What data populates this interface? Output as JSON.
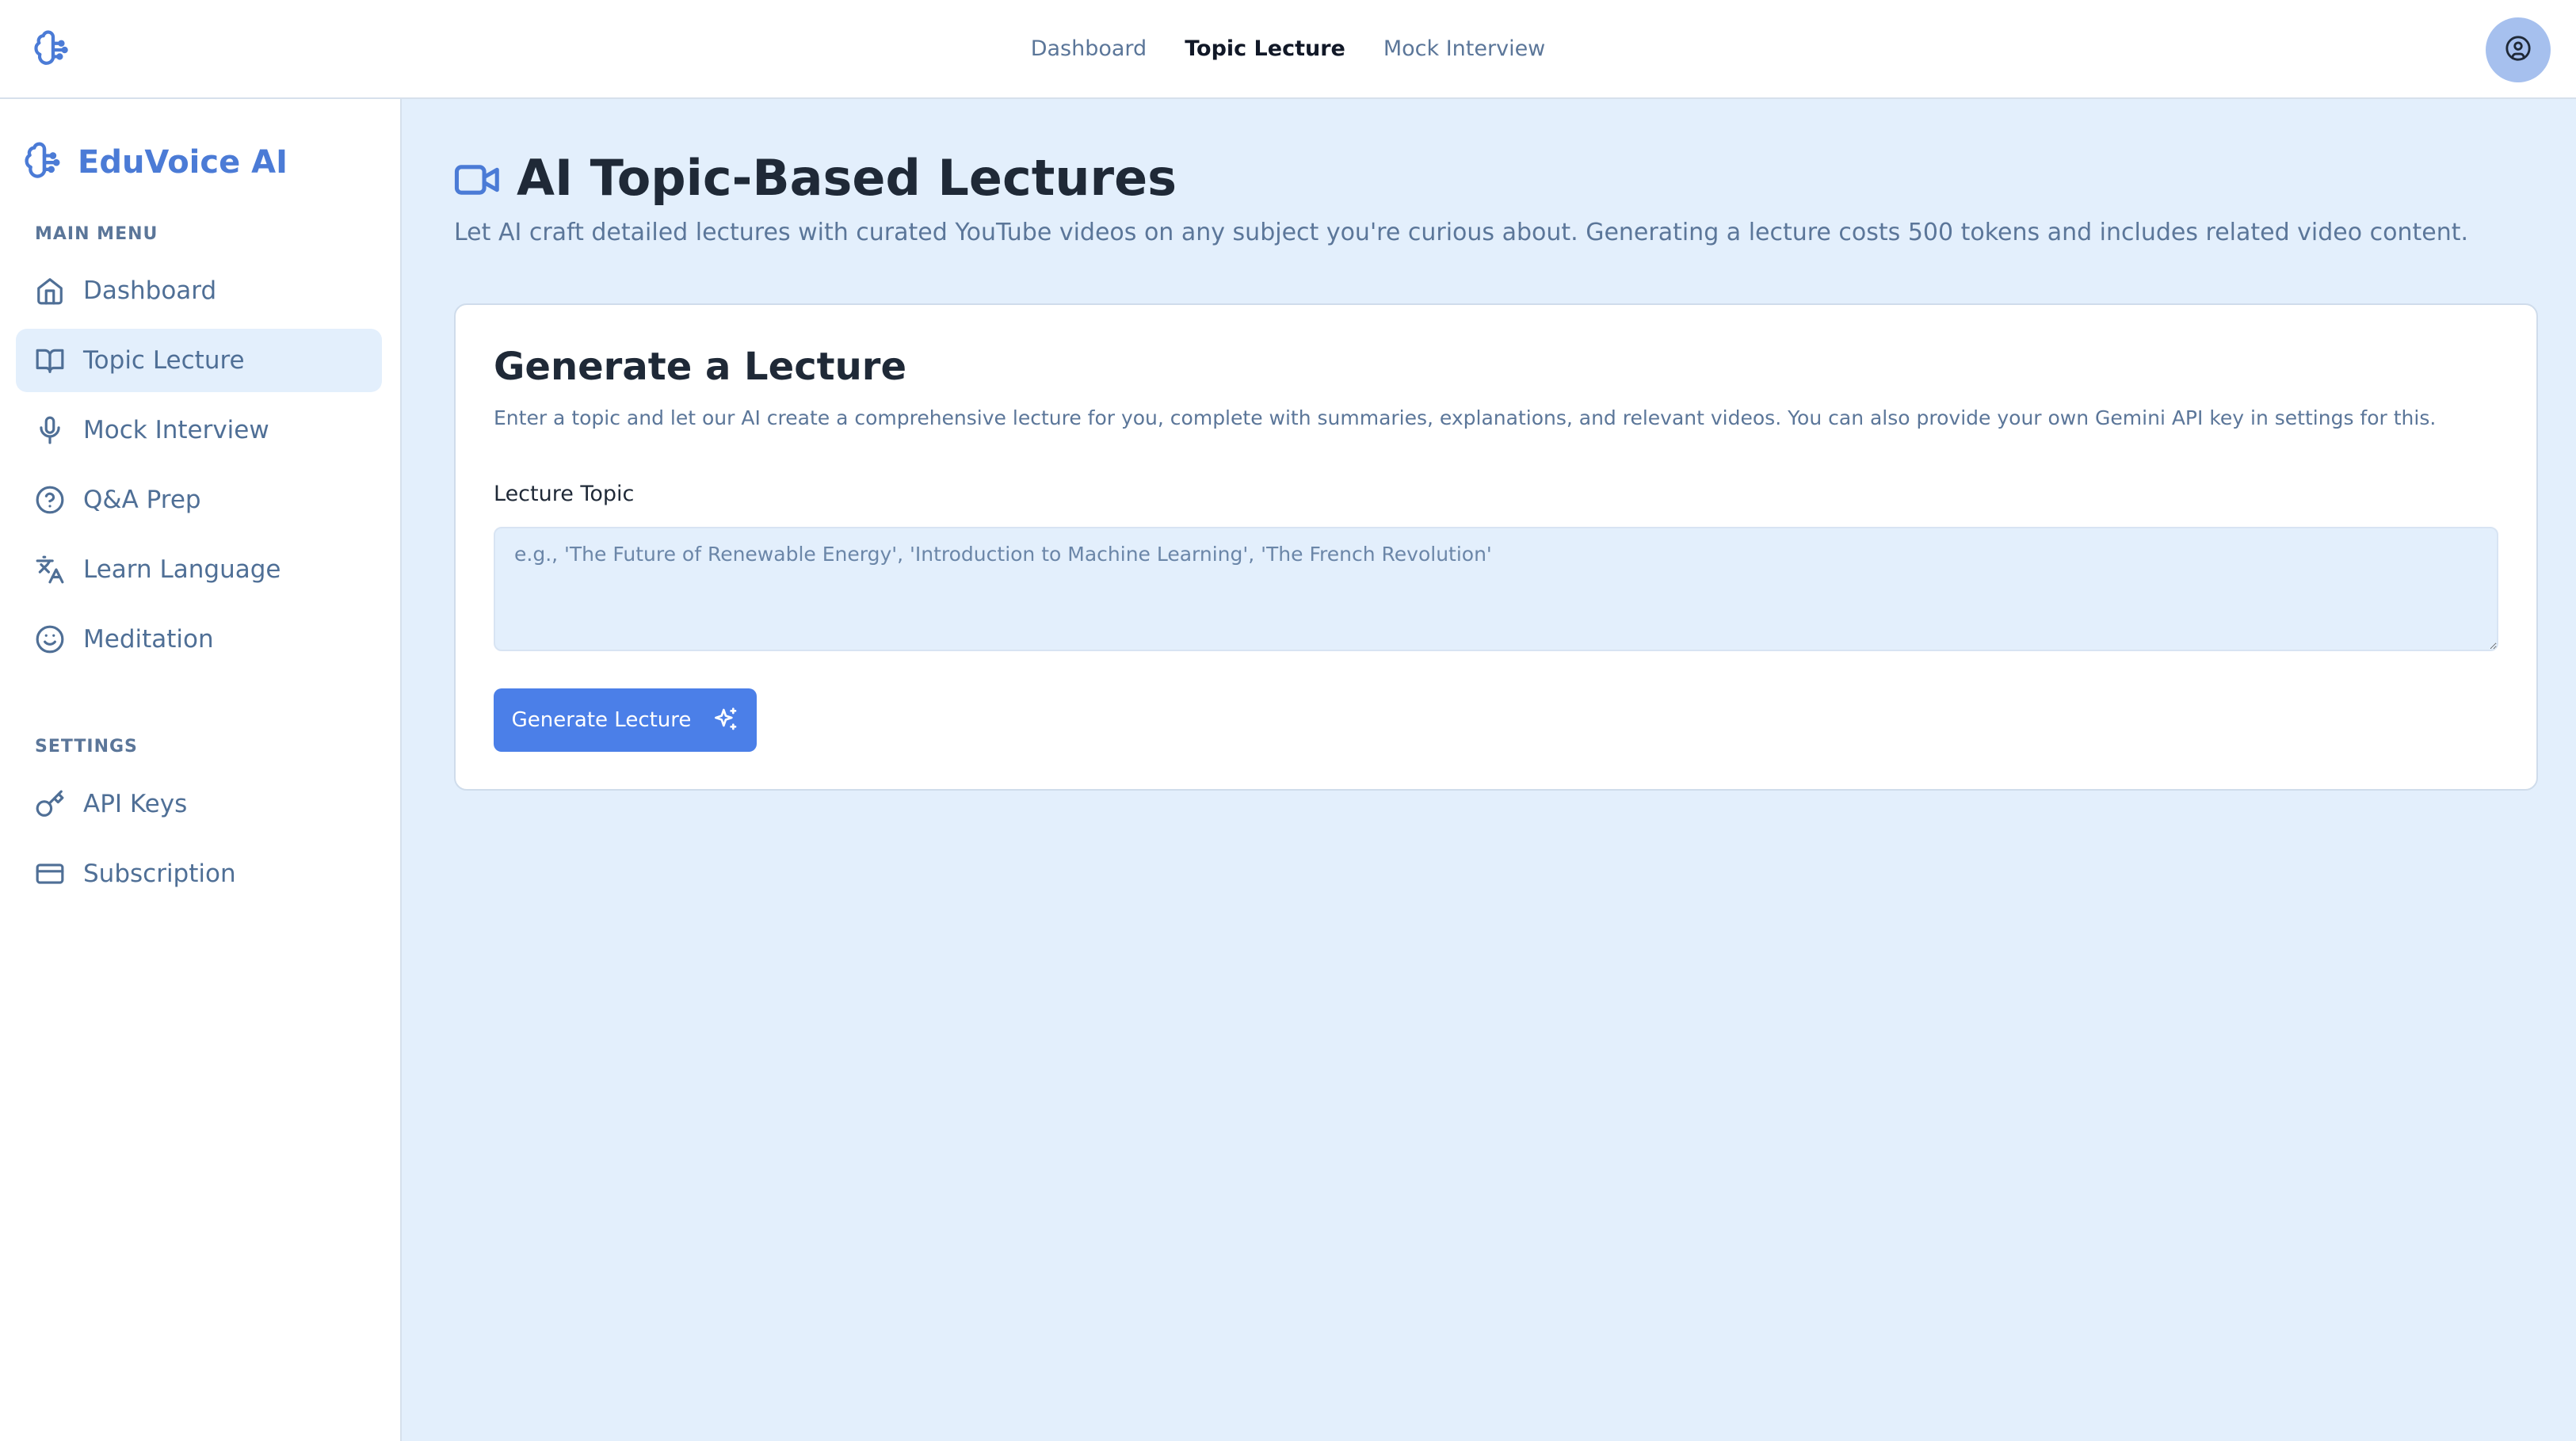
{
  "topnav": {
    "items": [
      {
        "label": "Dashboard",
        "active": false
      },
      {
        "label": "Topic Lecture",
        "active": true
      },
      {
        "label": "Mock Interview",
        "active": false
      }
    ]
  },
  "brand": {
    "name": "EduVoice AI",
    "icon": "brain-icon"
  },
  "sidebar": {
    "main_menu_title": "MAIN MENU",
    "main_items": [
      {
        "label": "Dashboard",
        "icon": "home-icon",
        "active": false
      },
      {
        "label": "Topic Lecture",
        "icon": "book-open-icon",
        "active": true
      },
      {
        "label": "Mock Interview",
        "icon": "mic-icon",
        "active": false
      },
      {
        "label": "Q&A Prep",
        "icon": "help-circle-icon",
        "active": false
      },
      {
        "label": "Learn Language",
        "icon": "languages-icon",
        "active": false
      },
      {
        "label": "Meditation",
        "icon": "smile-icon",
        "active": false
      }
    ],
    "settings_title": "SETTINGS",
    "settings_items": [
      {
        "label": "API Keys",
        "icon": "key-icon"
      },
      {
        "label": "Subscription",
        "icon": "credit-card-icon"
      }
    ]
  },
  "page": {
    "title": "AI Topic-Based Lectures",
    "subtitle": "Let AI craft detailed lectures with curated YouTube videos on any subject you're curious about. Generating a lecture costs 500 tokens and includes related video content."
  },
  "card": {
    "title": "Generate a Lecture",
    "description": "Enter a topic and let our AI create a comprehensive lecture for you, complete with summaries, explanations, and relevant videos. You can also provide your own Gemini API key in settings for this.",
    "field_label": "Lecture Topic",
    "topic_value": "",
    "topic_placeholder": "e.g., 'The Future of Renewable Energy', 'Introduction to Machine Learning', 'The French Revolution'",
    "button_label": "Generate Lecture"
  },
  "colors": {
    "accent": "#4b7fe8",
    "page_bg": "#e3effc",
    "muted_text": "#5b7699"
  }
}
